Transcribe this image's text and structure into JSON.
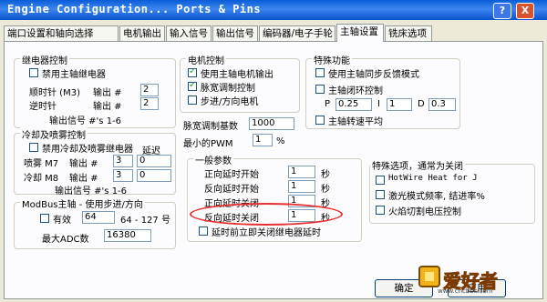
{
  "window": {
    "title": "Engine Configuration... Ports & Pins",
    "help_label": "?",
    "close_label": "X"
  },
  "tabs": [
    "端口设置和轴向选择",
    "电机输出",
    "输入信号",
    "输出信号",
    "编码器/电子手轮",
    "主轴设置",
    "铣床选项"
  ],
  "active_tab": "主轴设置",
  "relay": {
    "title": "继电器控制",
    "disable_label": "禁用主轴继电器",
    "cw_label": "顺时针 (M3)",
    "ccw_label": "逆时针",
    "output_label": "输出 #",
    "cw_value": "2",
    "ccw_value": "2",
    "signals_label": "输出信号 #'s 1-6"
  },
  "coolant": {
    "title": "冷却及喷雾控制",
    "disable_label": "禁用冷却及喷雾继电器",
    "delay_label": "延迟",
    "mist_label": "喷雾 M7",
    "flood_label": "冷却 M8",
    "output_label": "输出 #",
    "mist_value": "3",
    "mist_delay": "0",
    "flood_value": "3",
    "flood_delay": "0",
    "signals_label": "输出信号 #'s 1-6"
  },
  "modbus": {
    "title": "ModBus主轴 - 使用步进/方向",
    "enabled_label": "有效",
    "value": "64",
    "range_label": "64 - 127  号",
    "max_adc_label": "最大ADC数",
    "max_adc_value": "16380"
  },
  "motor": {
    "title": "电机控制",
    "use_spindle_motor_label": "使用主轴电机输出",
    "pwm_label": "脉宽调制控制",
    "step_dir_label": "步进/方向电机",
    "use_spindle_motor_checked": true,
    "pwm_checked": true,
    "pwm_base_label": "脉宽调制基数",
    "pwm_base_value": "1000",
    "min_pwm_label": "最小的PWM",
    "min_pwm_value": "1",
    "min_pwm_unit": "%"
  },
  "general": {
    "title": "一般参数",
    "fwd_on_label": "正向延时开始",
    "rev_on_label": "反向延时开始",
    "fwd_off_label": "正向延时关闭",
    "rev_off_label": "反向延时关闭",
    "fwd_on_value": "1",
    "rev_on_value": "1",
    "fwd_off_value": "1",
    "rev_off_value": "1",
    "unit": "秒",
    "relay_delay_label": "延时前立即关闭继电器延时",
    "highlight_color": "#e83030"
  },
  "special": {
    "title": "特殊功能",
    "sync_label": "使用主轴同步反馈模式",
    "closed_loop_label": "主轴闭环控制",
    "p_label": "P",
    "p_value": "0.25",
    "i_label": "I",
    "i_value": "1",
    "d_label": "D",
    "d_value": "0.3",
    "avg_label": "主轴转速平均"
  },
  "special_options": {
    "title": "特殊选项，通常为关闭",
    "hotwire_label": "HotWire Heat for J",
    "laser_label": "激光模式频率, 结进率%",
    "torch_label": "火焰切割电压控制"
  },
  "buttons": {
    "ok_label": "确定",
    "apply_label": "应用"
  },
  "watermark": {
    "text": "爱好者",
    "sub_text": "www.cncbbs.com"
  }
}
